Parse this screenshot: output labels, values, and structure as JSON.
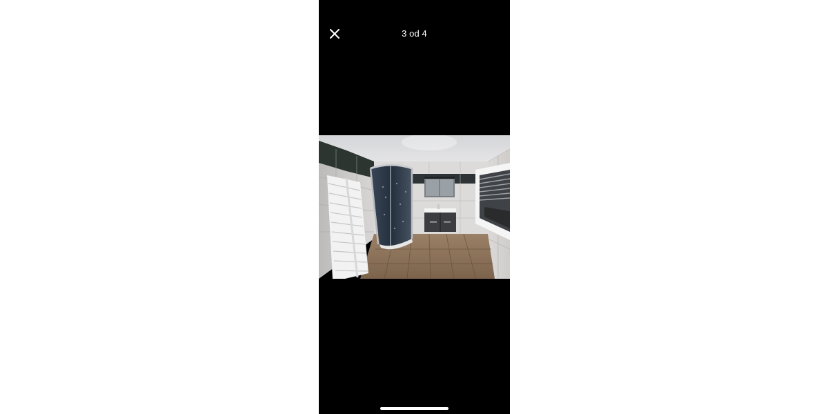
{
  "viewer": {
    "counter_text": "3 od 4",
    "current_index": 3,
    "total_count": 4
  },
  "icons": {
    "close": "close-icon"
  },
  "colors": {
    "page_background": "#ffffff",
    "viewer_background": "#000000",
    "foreground": "#ffffff"
  }
}
